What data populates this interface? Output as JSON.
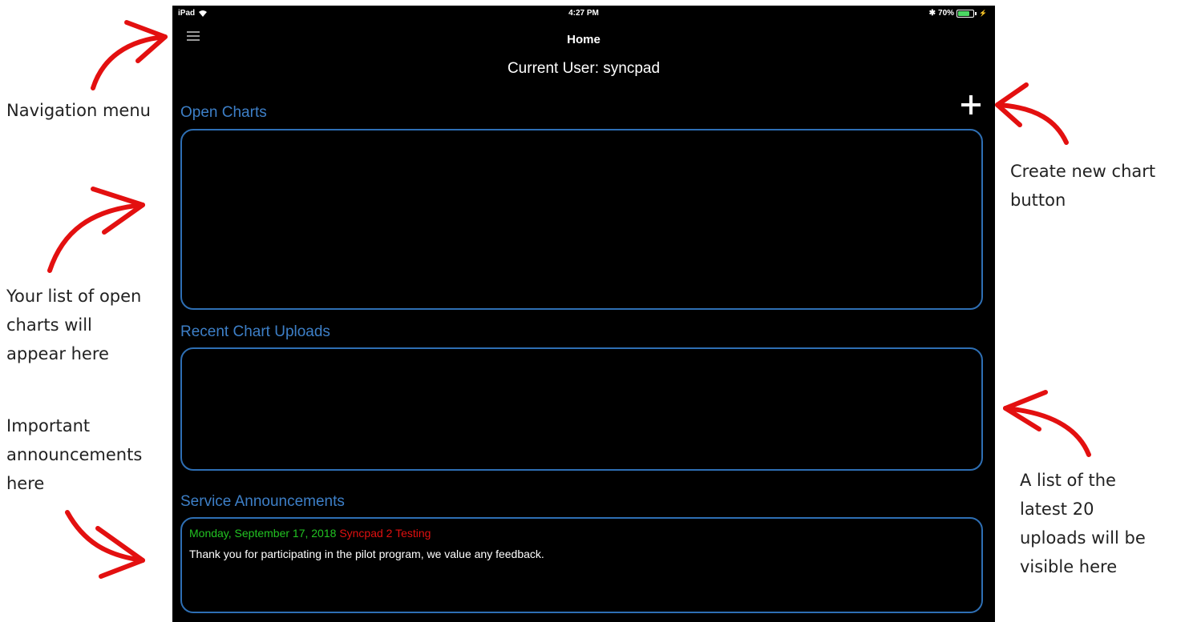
{
  "status_bar": {
    "device": "iPad",
    "time": "4:27 PM",
    "battery_percent_label": "70%",
    "battery_level": 0.7,
    "icons": [
      "wifi-icon",
      "bluetooth-icon",
      "battery-icon"
    ]
  },
  "nav": {
    "title": "Home",
    "menu_icon": "hamburger-menu-icon",
    "current_user": "Current User: syncpad"
  },
  "open_charts": {
    "title": "Open Charts",
    "add_icon": "plus-icon",
    "items": []
  },
  "recent_uploads": {
    "title": "Recent Chart Uploads",
    "items": []
  },
  "service_announcements": {
    "title": "Service Announcements",
    "items": [
      {
        "date": "Monday, September 17, 2018",
        "title": "Syncpad 2 Testing",
        "body": "Thank you for participating in the pilot program, we value any feedback."
      }
    ]
  },
  "annotations": {
    "navigation_menu": "Navigation menu",
    "open_charts_line1": "Your list of open",
    "open_charts_line2": "charts will",
    "open_charts_line3": "appear here",
    "announcements_line1": "Important",
    "announcements_line2": "announcements",
    "announcements_line3": "here",
    "create_line1": "Create new chart",
    "create_line2": "button",
    "uploads_line1": "A list of the",
    "uploads_line2": "latest 20",
    "uploads_line3": "uploads will be",
    "uploads_line4": "visible here"
  },
  "colors": {
    "accent_blue": "#3d7fc7",
    "border_blue": "#2e6fb4",
    "date_green": "#22c322",
    "title_red": "#e01010",
    "arrow_red": "#e31010"
  }
}
